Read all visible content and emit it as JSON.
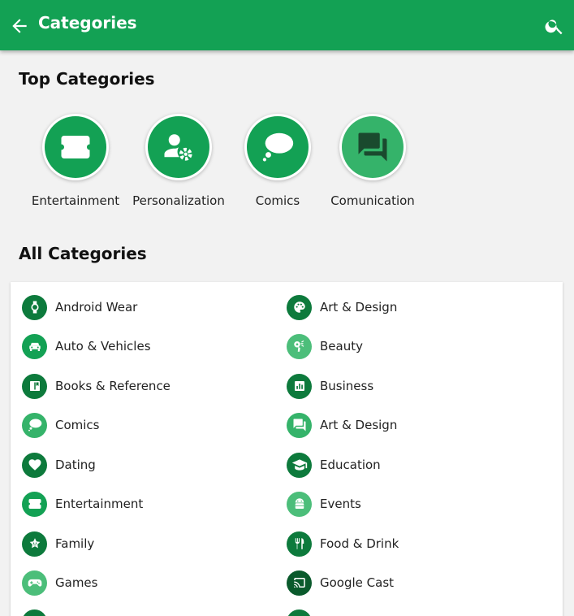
{
  "appbar": {
    "title": "Categories",
    "back_icon": "arrow-back-icon",
    "search_icon": "search-icon",
    "color": "#13a154"
  },
  "sections": {
    "top_title": "Top Categories",
    "all_title": "All Categories"
  },
  "top_categories": [
    {
      "label": "Entertainment",
      "icon": "ticket-icon",
      "color": "#13a154"
    },
    {
      "label": "Personalization",
      "icon": "person-gear-icon",
      "color": "#13a154"
    },
    {
      "label": "Comics",
      "icon": "thought-bubble-icon",
      "color": "#13a154"
    },
    {
      "label": "Comunication",
      "icon": "forum-icon",
      "color": "#35b36a"
    }
  ],
  "all_categories": {
    "left": [
      {
        "label": "Android Wear",
        "icon": "watch-icon",
        "color": "#0d7a3c"
      },
      {
        "label": "Auto & Vehicles",
        "icon": "car-icon",
        "color": "#13a154"
      },
      {
        "label": "Books & Reference",
        "icon": "book-icon",
        "color": "#0d7a3c"
      },
      {
        "label": "Comics",
        "icon": "thought-bubble-icon",
        "color": "#35b36a"
      },
      {
        "label": "Dating",
        "icon": "heart-icon",
        "color": "#0d7a3c"
      },
      {
        "label": "Entertainment",
        "icon": "ticket-icon",
        "color": "#13a154"
      },
      {
        "label": "Family",
        "icon": "family-icon",
        "color": "#0d7a3c"
      },
      {
        "label": "Games",
        "icon": "gamepad-icon",
        "color": "#4cbe7a"
      }
    ],
    "right": [
      {
        "label": "Art & Design",
        "icon": "palette-icon",
        "color": "#0d7a3c"
      },
      {
        "label": "Beauty",
        "icon": "hair-dryer-icon",
        "color": "#4cbe7a"
      },
      {
        "label": "Business",
        "icon": "bar-chart-icon",
        "color": "#0d7a3c"
      },
      {
        "label": "Art & Design",
        "icon": "forum-icon",
        "color": "#35b36a"
      },
      {
        "label": "Education",
        "icon": "school-icon",
        "color": "#0d7a3c"
      },
      {
        "label": "Events",
        "icon": "android-icon",
        "color": "#4cbe7a"
      },
      {
        "label": "Food & Drink",
        "icon": "cutlery-icon",
        "color": "#0d7a3c"
      },
      {
        "label": "Google Cast",
        "icon": "cast-icon",
        "color": "#0a5a2c"
      }
    ]
  }
}
